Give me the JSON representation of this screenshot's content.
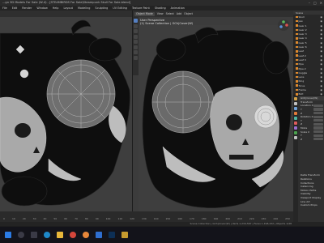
{
  "window": {
    "title": "...gn 3D Models For Sale (W-4) - [STEAMBIRDS For Sale\\Steampunk Skull For Sale.blend]",
    "controls": [
      "minimize",
      "maximize",
      "close"
    ]
  },
  "menubar": {
    "items": [
      "File",
      "Edit",
      "Render",
      "Window",
      "Help",
      "Layout",
      "Modeling",
      "Sculpting",
      "UV Editing",
      "Texture Paint",
      "Shading",
      "Animation"
    ]
  },
  "viewport_right": {
    "mode": "Object Mode",
    "buttons": [
      "View",
      "Select",
      "Add",
      "Object"
    ],
    "overlay_line1": "User Perspective",
    "overlay_line2": "(1) Scene Collection | GCh|Cover(W)"
  },
  "outliner": {
    "header": "Scene",
    "items": [
      "Skull",
      "Jaw",
      "Gear 1",
      "Gear 2",
      "Gear 3",
      "Gear 4",
      "Gear 5",
      "Gear 6",
      "Leaf",
      "Leaf 2",
      "Leaf 3",
      "Pipe",
      "Pipe 2",
      "Goggle",
      "Lens",
      "Ring",
      "Torus",
      "Frame",
      "Bolt"
    ]
  },
  "properties": {
    "object_name": "GCh|Cover(W)",
    "rows": [
      "Transform",
      "Location X",
      "Y",
      "Z",
      "Rotation X",
      "Y",
      "Z",
      "Mode",
      "Scale X",
      "Y",
      "Z",
      "Delta Transform",
      "Relations",
      "Collections",
      "Instancing",
      "Motion Paths",
      "Visibility",
      "Viewport Display",
      "Line Art",
      "Custom Props"
    ],
    "tab_colors": [
      "#d3a24a",
      "#c0c0c0",
      "#6fa1d8",
      "#e27b3a",
      "#4fb6a3",
      "#dd5b5b",
      "#9b6fd1",
      "#4aa14e",
      "#c0c0c0"
    ]
  },
  "timeline": {
    "ticks": [
      "0",
      "10",
      "20",
      "30",
      "40",
      "50",
      "60",
      "70",
      "80",
      "90",
      "100",
      "110",
      "120",
      "130",
      "140",
      "150",
      "160",
      "170",
      "180",
      "190",
      "200",
      "210",
      "220",
      "230",
      "240",
      "250"
    ]
  },
  "statusbar": {
    "text": "Scene Collection | GCh|Cover(W) | Verts 1,234,567 | Faces 1,198,432 | Objects 1/48"
  },
  "taskbar": {
    "icons": [
      "windows-icon",
      "search-icon",
      "task-view-icon",
      "edge-icon",
      "explorer-icon",
      "chrome-icon",
      "blender-icon",
      "mail-icon",
      "photoshop-icon",
      "folder-icon"
    ]
  }
}
